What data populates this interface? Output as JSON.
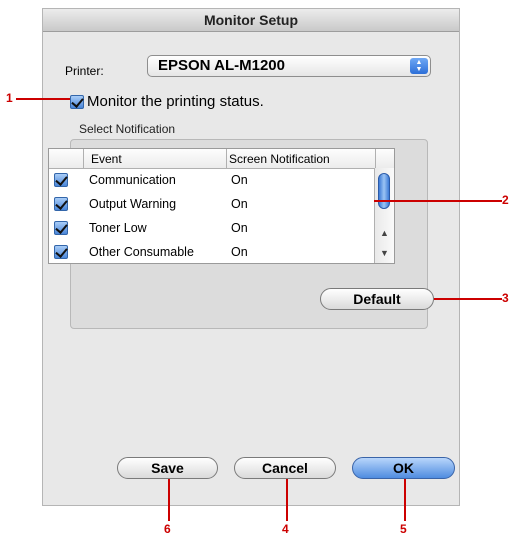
{
  "window": {
    "title": "Monitor Setup"
  },
  "printer": {
    "label": "Printer:",
    "value": "EPSON AL-M1200"
  },
  "monitor": {
    "label": "Monitor the printing status.",
    "checked": true
  },
  "notification": {
    "group_label": "Select Notification",
    "columns": [
      "Event",
      "Screen Notification"
    ],
    "rows": [
      {
        "event": "Communication",
        "screen": "On",
        "checked": true
      },
      {
        "event": "Output Warning",
        "screen": "On",
        "checked": true
      },
      {
        "event": "Toner Low",
        "screen": "On",
        "checked": true
      },
      {
        "event": "Other Consumable",
        "screen": "On",
        "checked": true
      }
    ],
    "default_button": "Default"
  },
  "footer": {
    "save": "Save",
    "cancel": "Cancel",
    "ok": "OK"
  },
  "callouts": [
    "1",
    "2",
    "3",
    "4",
    "5",
    "6"
  ],
  "colors": {
    "callout": "#cc0000",
    "accent": "#4f8ce0"
  }
}
